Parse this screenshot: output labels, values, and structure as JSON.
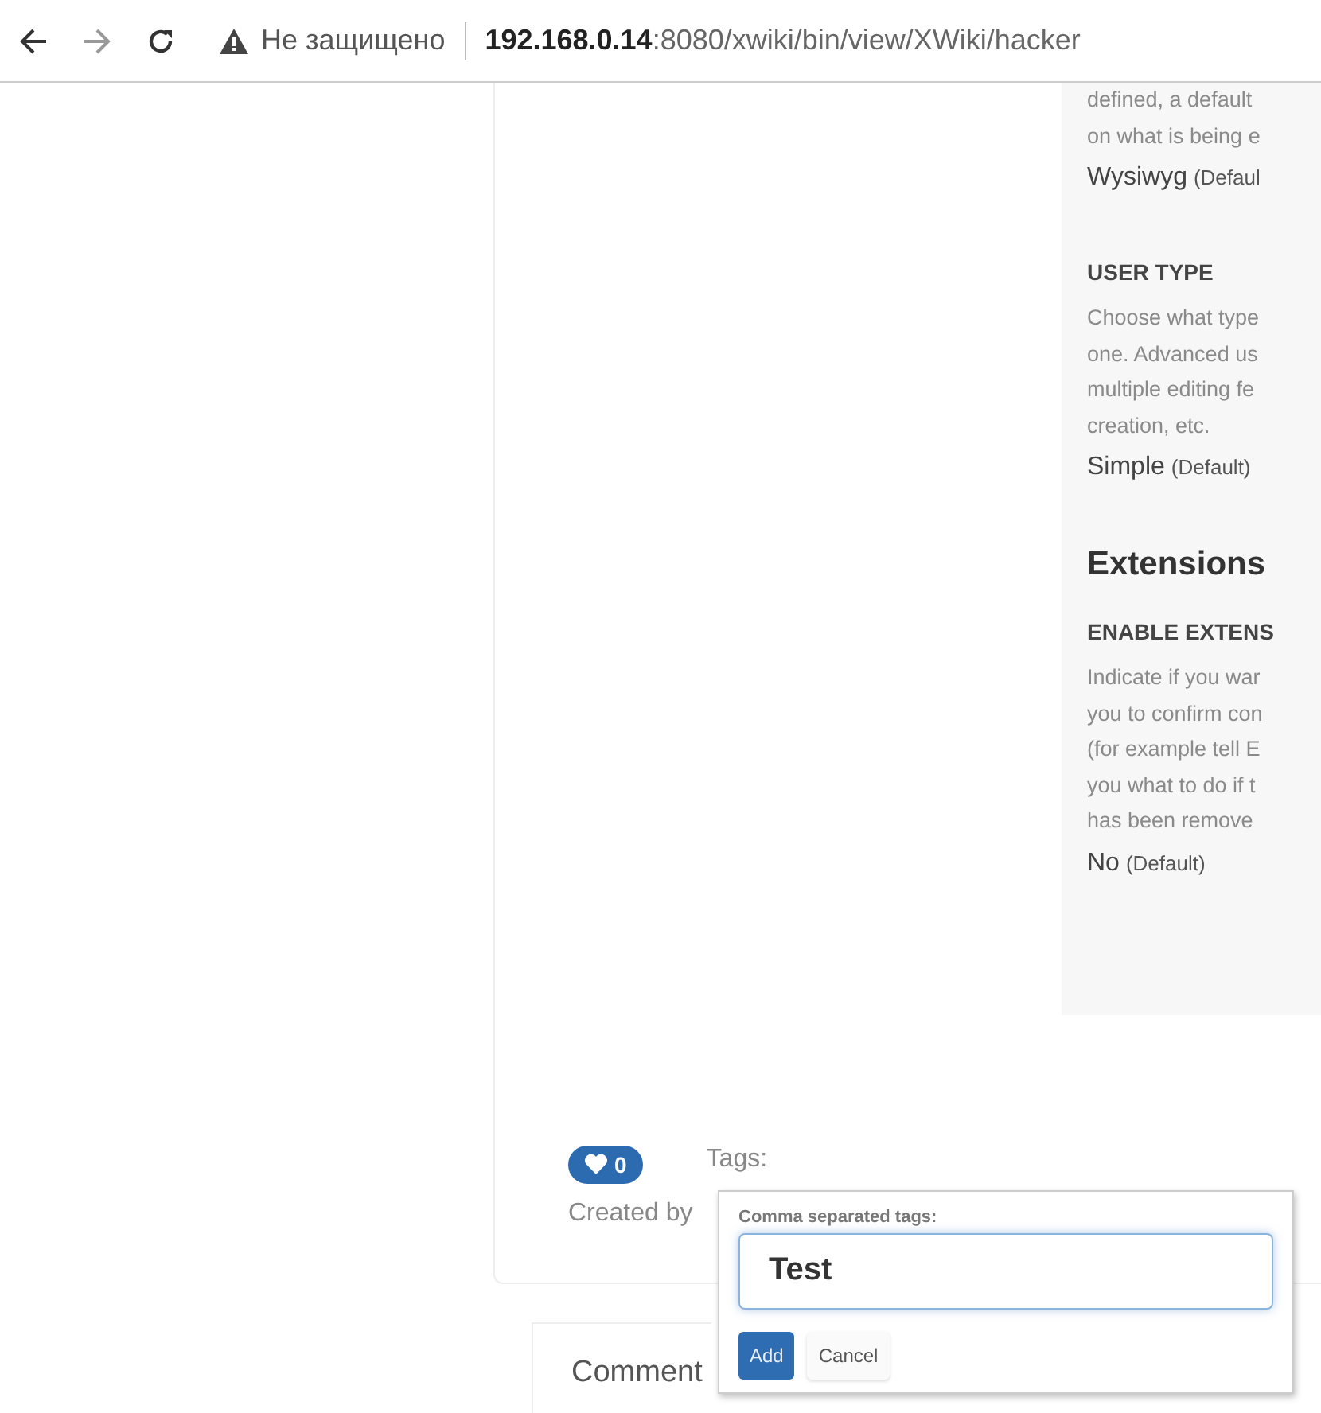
{
  "address_bar": {
    "security": "Не защищено",
    "host": "192.168.0.14",
    "path": ":8080/xwiki/bin/view/XWiki/hacker"
  },
  "panel": {
    "sections": [
      {
        "kind": "field",
        "lines": [
          "defined, a default",
          "on what is being e"
        ],
        "value": "Wysiwyg",
        "default": "(Defaul"
      },
      {
        "kind": "field",
        "title": "USER TYPE",
        "lines": [
          "Choose what type",
          "one. Advanced us",
          "multiple editing fe",
          "creation, etc."
        ],
        "value": "Simple",
        "default": "(Default)"
      },
      {
        "kind": "heading",
        "title": "Extensions"
      },
      {
        "kind": "field",
        "title": "ENABLE EXTENS",
        "lines": [
          "Indicate if you war",
          "you to confirm con",
          "(for example tell E",
          "you what to do if t",
          "has been remove"
        ],
        "value": "No",
        "default": "(Default)"
      }
    ]
  },
  "like": {
    "count": "0"
  },
  "tags": {
    "label": "Tags:"
  },
  "created_by": "Created by",
  "comments": {
    "title": "Comment"
  },
  "tag_popup": {
    "label": "Comma separated tags:",
    "value": "Test",
    "buttons": [
      {
        "label": "Add",
        "kind": "primary"
      },
      {
        "label": "Cancel",
        "kind": "secondary"
      }
    ]
  }
}
